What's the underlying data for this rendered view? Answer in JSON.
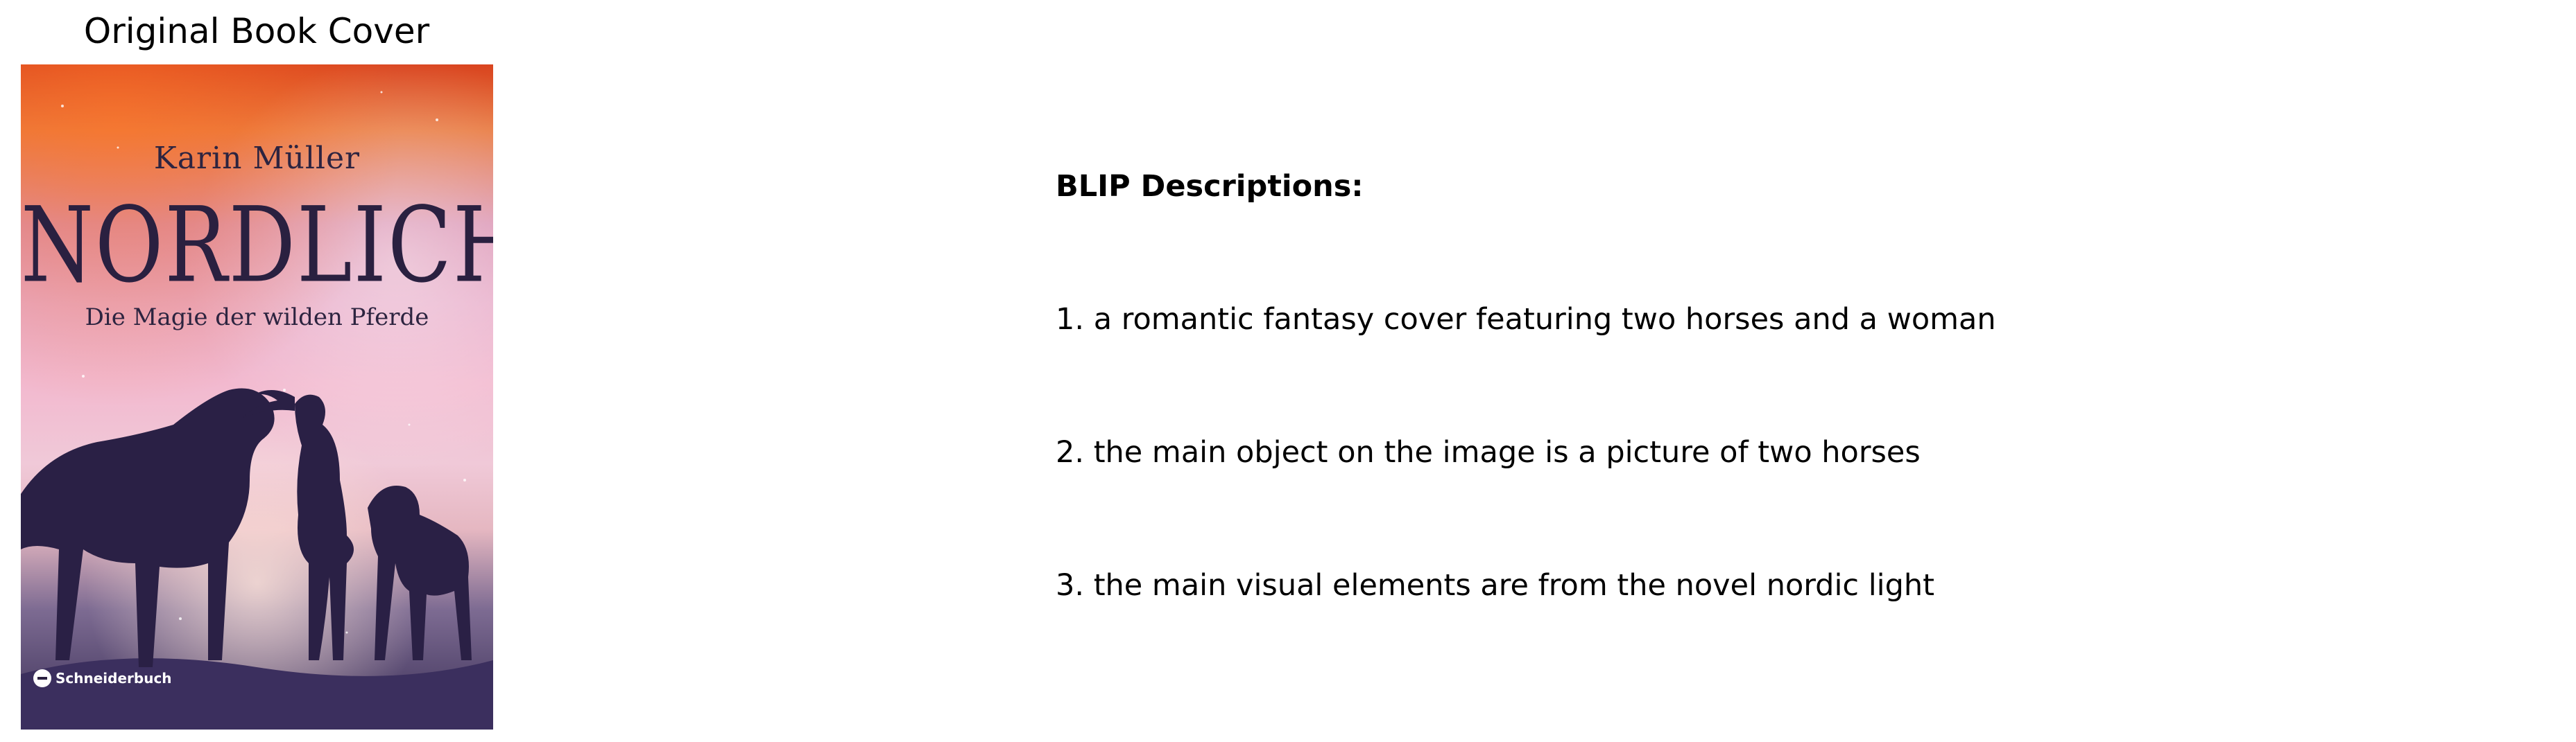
{
  "panel_title": "Original Book Cover",
  "cover": {
    "author": "Karin Müller",
    "title": "NORDLICHT",
    "subtitle": "Die Magie der wilden Pferde",
    "publisher": "Schneiderbuch",
    "colors": {
      "sky_top": "#d9441f",
      "sky_mid": "#e7a9c7",
      "silhouette": "#2a2045"
    }
  },
  "descriptions": {
    "heading": "BLIP Descriptions:",
    "items": [
      "1. a romantic fantasy cover featuring two horses and a woman",
      "2. the main object on the image is a picture of two horses",
      "3. the main visual elements are from the novel nordic light"
    ]
  }
}
